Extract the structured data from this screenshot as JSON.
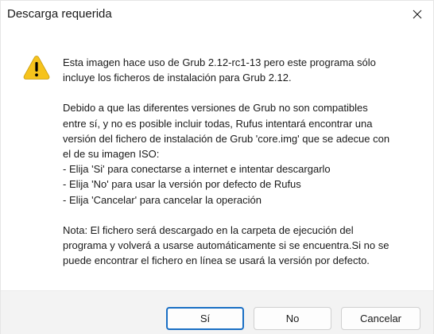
{
  "window": {
    "title": "Descarga requerida",
    "close_icon": "close-icon"
  },
  "icon": {
    "name": "warning-icon",
    "color_fill": "#f6c31c",
    "color_mark": "#000000"
  },
  "message": {
    "para1": [
      "Esta imagen hace uso de Grub 2.12-rc1-13 pero este programa sólo",
      "incluye los ficheros de instalación para Grub 2.12."
    ],
    "para2": [
      "Debido a que las diferentes versiones de Grub no son compatibles",
      "entre sí, y no es posible incluir todas, Rufus intentará encontrar una",
      "versión del fichero de instalación de Grub 'core.img' que se adecue con",
      "el de su imagen ISO:",
      "- Elija 'Si' para conectarse a internet e intentar descargarlo",
      "- Elija 'No' para usar la versión por defecto de Rufus",
      "- Elija 'Cancelar' para cancelar la operación"
    ],
    "para3": [
      "Nota: El fichero será descargado en la carpeta de ejecución del",
      "programa y volverá a usarse automáticamente si se encuentra.Si no se",
      "puede encontrar el fichero en línea se usará la versión por defecto."
    ]
  },
  "buttons": {
    "yes": "Sí",
    "no": "No",
    "cancel": "Cancelar"
  },
  "colors": {
    "footer_bg": "#f3f3f3",
    "primary_border": "#1a6fc4"
  }
}
